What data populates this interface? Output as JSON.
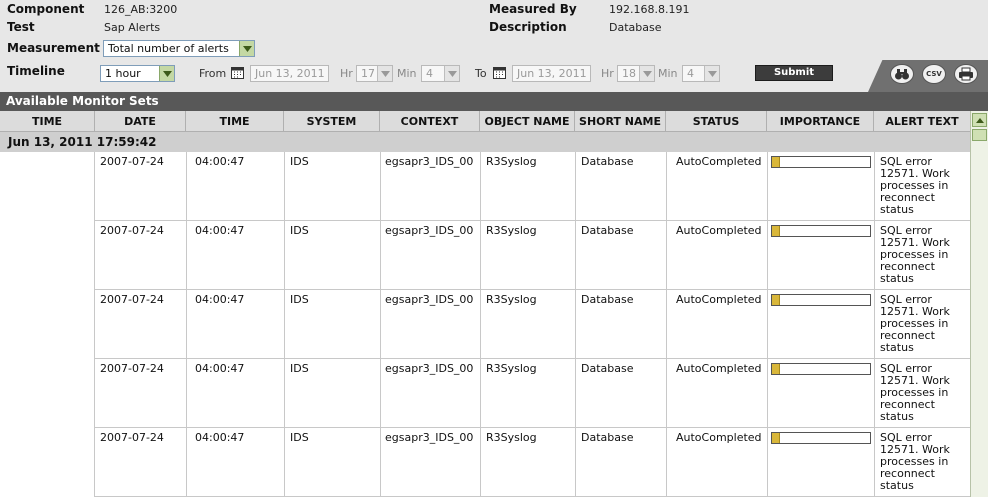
{
  "header": {
    "component_label": "Component",
    "component_value": "126_AB:3200",
    "test_label": "Test",
    "test_value": "Sap Alerts",
    "measured_by_label": "Measured By",
    "measured_by_value": "192.168.8.191",
    "description_label": "Description",
    "description_value": "Database",
    "measurement_label": "Measurement",
    "measurement_selected": "Total number of alerts",
    "timeline_label": "Timeline",
    "timeline_selected": "1 hour",
    "from_label": "From",
    "from_date": "Jun 13, 2011",
    "from_hr_label": "Hr",
    "from_hr": "17",
    "from_min_label": "Min",
    "from_min": "4",
    "to_label": "To",
    "to_date": "Jun 13, 2011",
    "to_hr_label": "Hr",
    "to_hr": "18",
    "to_min_label": "Min",
    "to_min": "4",
    "submit_label": "Submit",
    "csv_label": "CSV"
  },
  "section_title": "Available Monitor Sets",
  "table": {
    "columns": [
      "TIME",
      "DATE",
      "TIME",
      "SYSTEM",
      "CONTEXT",
      "OBJECT NAME",
      "SHORT NAME",
      "STATUS",
      "IMPORTANCE",
      "ALERT TEXT"
    ],
    "group_timestamp": "Jun 13, 2011 17:59:42",
    "rows": [
      {
        "date": "2007-07-24",
        "time": "04:00:47",
        "system": "IDS",
        "context": "egsapr3_IDS_00",
        "object_name": "R3Syslog",
        "short_name": "Database",
        "status": "AutoCompleted",
        "importance": 0.08,
        "alert_text": "SQL error 12571. Work processes in reconnect status"
      },
      {
        "date": "2007-07-24",
        "time": "04:00:47",
        "system": "IDS",
        "context": "egsapr3_IDS_00",
        "object_name": "R3Syslog",
        "short_name": "Database",
        "status": "AutoCompleted",
        "importance": 0.08,
        "alert_text": "SQL error 12571. Work processes in reconnect status"
      },
      {
        "date": "2007-07-24",
        "time": "04:00:47",
        "system": "IDS",
        "context": "egsapr3_IDS_00",
        "object_name": "R3Syslog",
        "short_name": "Database",
        "status": "AutoCompleted",
        "importance": 0.08,
        "alert_text": "SQL error 12571. Work processes in reconnect status"
      },
      {
        "date": "2007-07-24",
        "time": "04:00:47",
        "system": "IDS",
        "context": "egsapr3_IDS_00",
        "object_name": "R3Syslog",
        "short_name": "Database",
        "status": "AutoCompleted",
        "importance": 0.08,
        "alert_text": "SQL error 12571. Work processes in reconnect status"
      },
      {
        "date": "2007-07-24",
        "time": "04:00:47",
        "system": "IDS",
        "context": "egsapr3_IDS_00",
        "object_name": "R3Syslog",
        "short_name": "Database",
        "status": "AutoCompleted",
        "importance": 0.08,
        "alert_text": "SQL error 12571. Work processes in reconnect status"
      }
    ]
  },
  "colors": {
    "header_bg": "#e7e7e7",
    "section_bar": "#585858",
    "importance_fill": "#d9b73a"
  }
}
